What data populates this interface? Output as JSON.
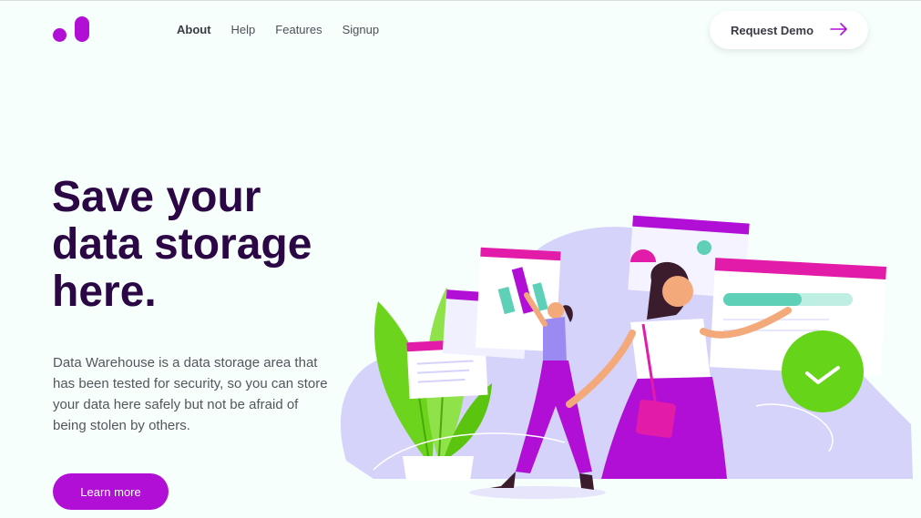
{
  "nav": {
    "items": [
      {
        "label": "About",
        "active": true
      },
      {
        "label": "Help",
        "active": false
      },
      {
        "label": "Features",
        "active": false
      },
      {
        "label": "Signup",
        "active": false
      }
    ],
    "cta_label": "Request Demo",
    "cta_icon": "arrow-right-icon"
  },
  "hero": {
    "headline": "Save your data storage here.",
    "description": "Data Warehouse is a data storage area that has been tested for security, so you can store your data here safely but not be afraid of being stolen by others.",
    "button_label": "Learn more"
  },
  "colors": {
    "brand": "#b10fd6",
    "headline": "#2b0845",
    "background": "#f6fffc",
    "accent_green": "#66d418",
    "blob": "#d5d3fa"
  }
}
